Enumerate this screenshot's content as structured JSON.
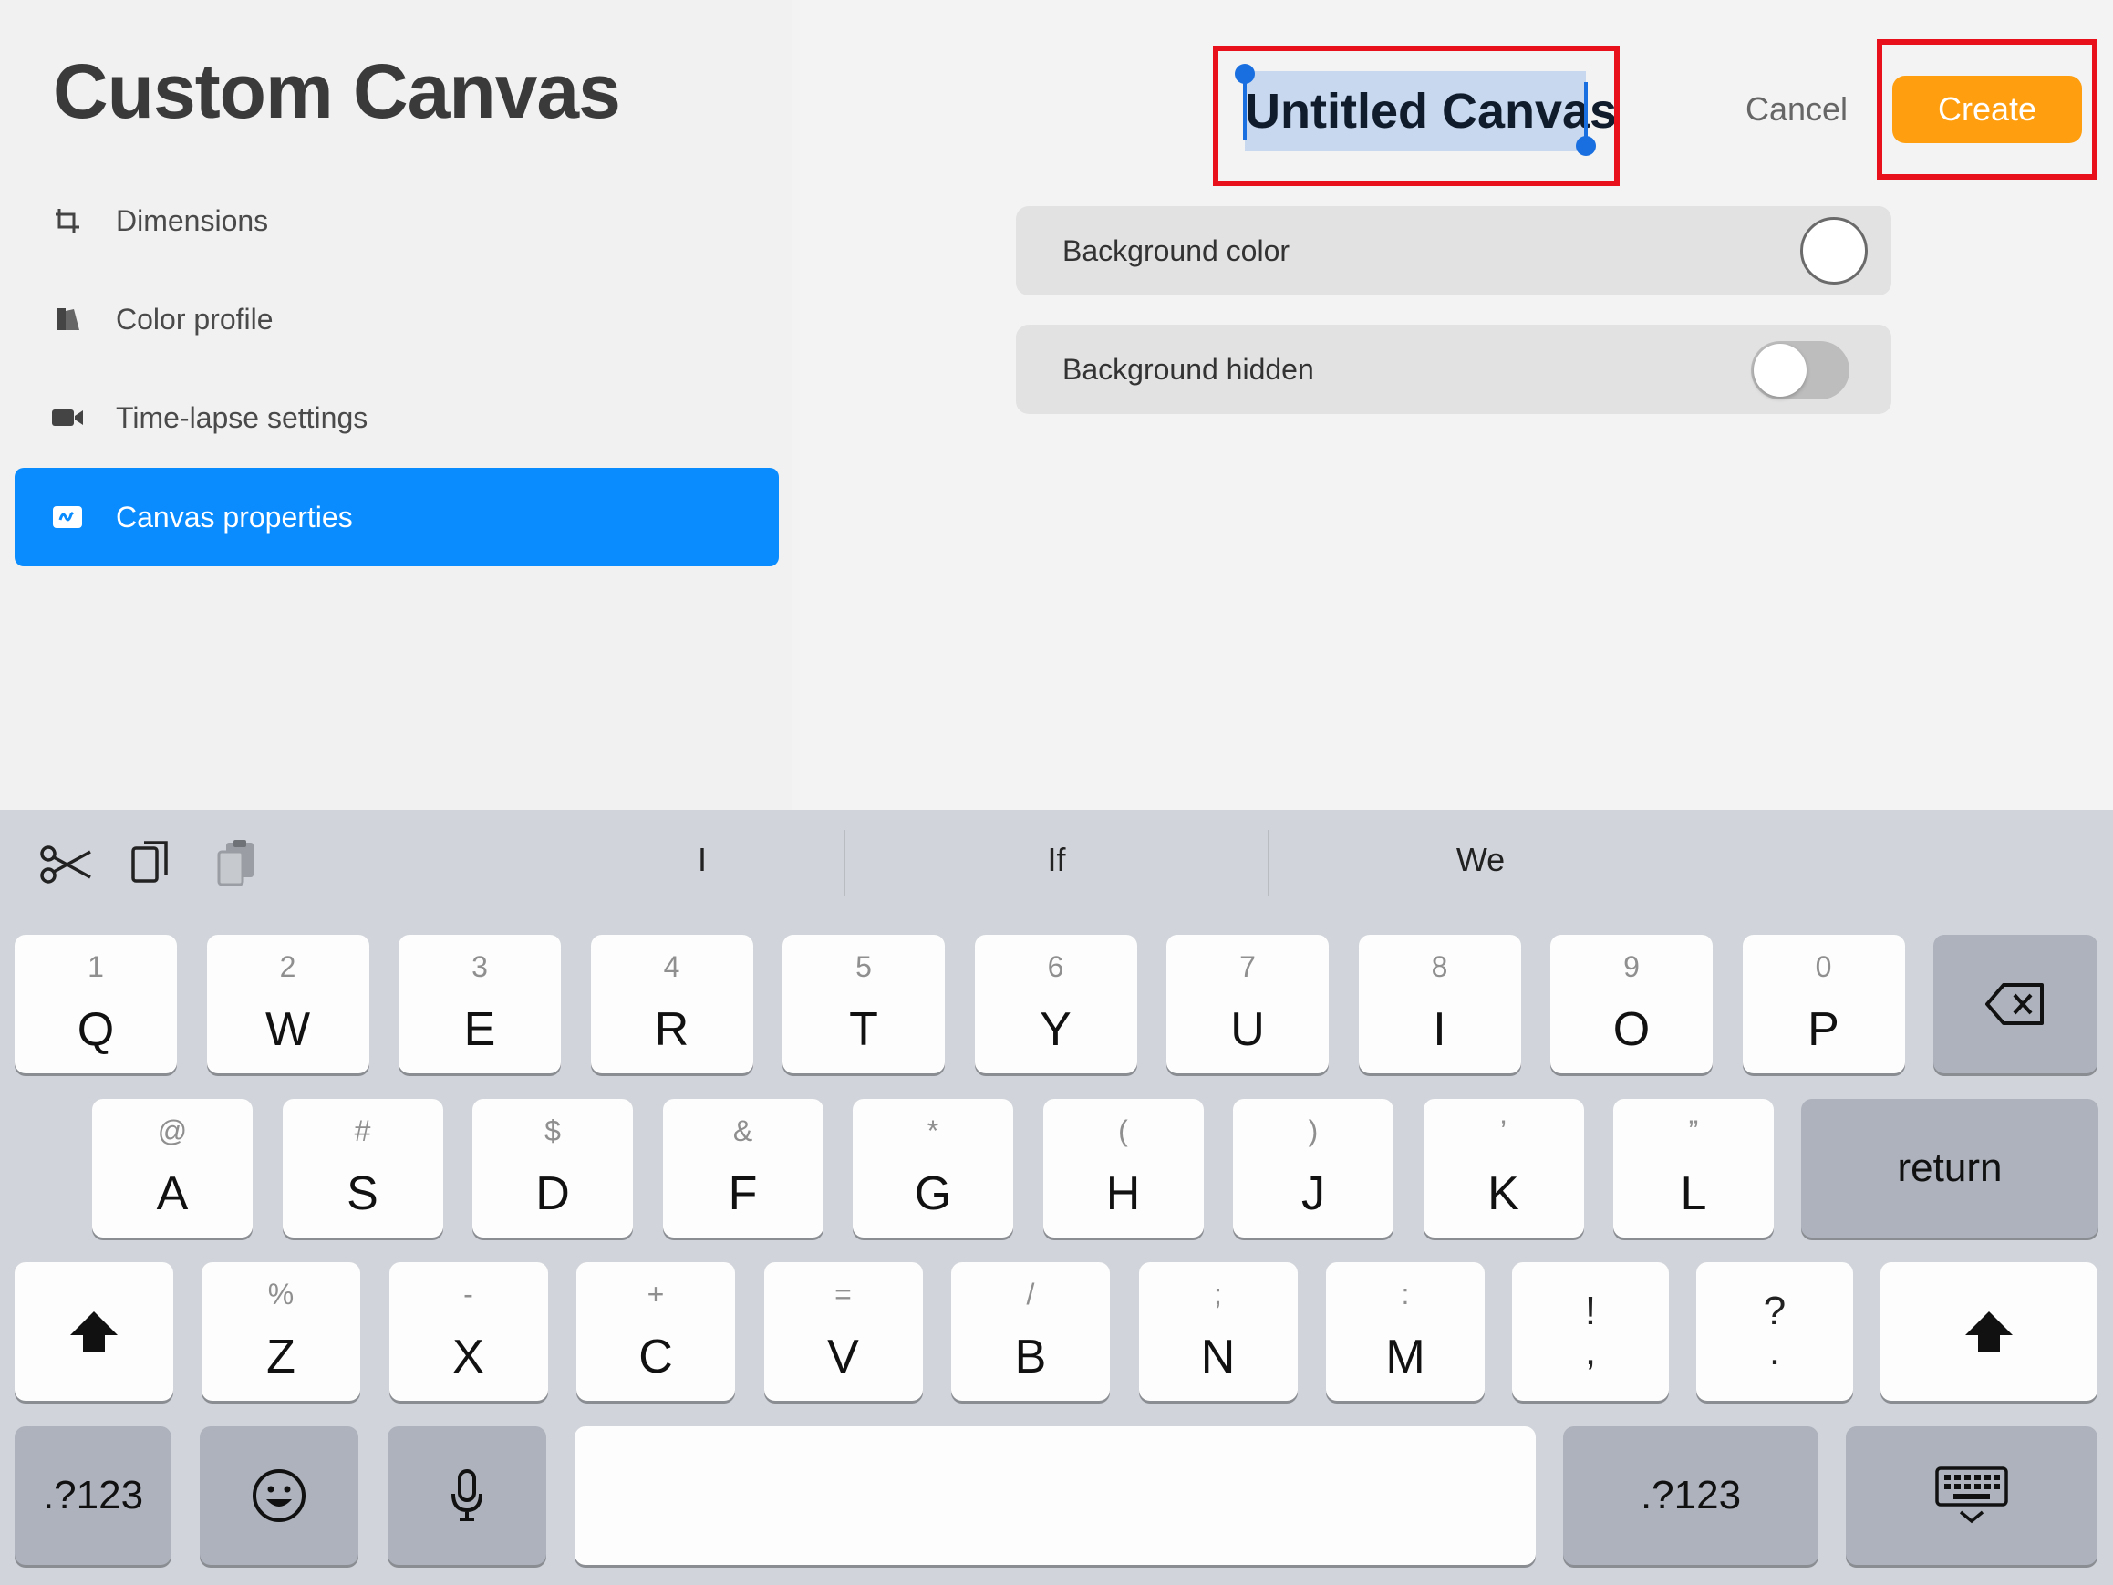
{
  "sidebar": {
    "title": "Custom Canvas",
    "items": [
      {
        "label": "Dimensions",
        "icon": "crop-icon",
        "active": false
      },
      {
        "label": "Color profile",
        "icon": "color-profile-icon",
        "active": false
      },
      {
        "label": "Time-lapse settings",
        "icon": "video-camera-icon",
        "active": false
      },
      {
        "label": "Canvas properties",
        "icon": "canvas-properties-icon",
        "active": true
      }
    ]
  },
  "header": {
    "canvas_name": "Untitled Canvas",
    "cancel_label": "Cancel",
    "create_label": "Create"
  },
  "properties": {
    "background_color_label": "Background color",
    "background_color_value": "#ffffff",
    "background_hidden_label": "Background hidden",
    "background_hidden_on": false
  },
  "keyboard": {
    "suggestions": [
      "I",
      "If",
      "We"
    ],
    "row1": [
      {
        "alt": "1",
        "main": "Q"
      },
      {
        "alt": "2",
        "main": "W"
      },
      {
        "alt": "3",
        "main": "E"
      },
      {
        "alt": "4",
        "main": "R"
      },
      {
        "alt": "5",
        "main": "T"
      },
      {
        "alt": "6",
        "main": "Y"
      },
      {
        "alt": "7",
        "main": "U"
      },
      {
        "alt": "8",
        "main": "I"
      },
      {
        "alt": "9",
        "main": "O"
      },
      {
        "alt": "0",
        "main": "P"
      }
    ],
    "row2": [
      {
        "alt": "@",
        "main": "A"
      },
      {
        "alt": "#",
        "main": "S"
      },
      {
        "alt": "$",
        "main": "D"
      },
      {
        "alt": "&",
        "main": "F"
      },
      {
        "alt": "*",
        "main": "G"
      },
      {
        "alt": "(",
        "main": "H"
      },
      {
        "alt": ")",
        "main": "J"
      },
      {
        "alt": "’",
        "main": "K"
      },
      {
        "alt": "”",
        "main": "L"
      }
    ],
    "row3": [
      {
        "alt": "%",
        "main": "Z"
      },
      {
        "alt": "-",
        "main": "X"
      },
      {
        "alt": "+",
        "main": "C"
      },
      {
        "alt": "=",
        "main": "V"
      },
      {
        "alt": "/",
        "main": "B"
      },
      {
        "alt": ";",
        "main": "N"
      },
      {
        "alt": ":",
        "main": "M"
      }
    ],
    "punct1": {
      "top": "!",
      "bottom": ","
    },
    "punct2": {
      "top": "?",
      "bottom": "."
    },
    "return_label": "return",
    "numbers_label": ".?123"
  },
  "colors": {
    "accent_blue": "#0a8cff",
    "create_orange": "#ff9f0f",
    "highlight_red": "#e8101a",
    "selection_blue": "#1a6fe0"
  }
}
